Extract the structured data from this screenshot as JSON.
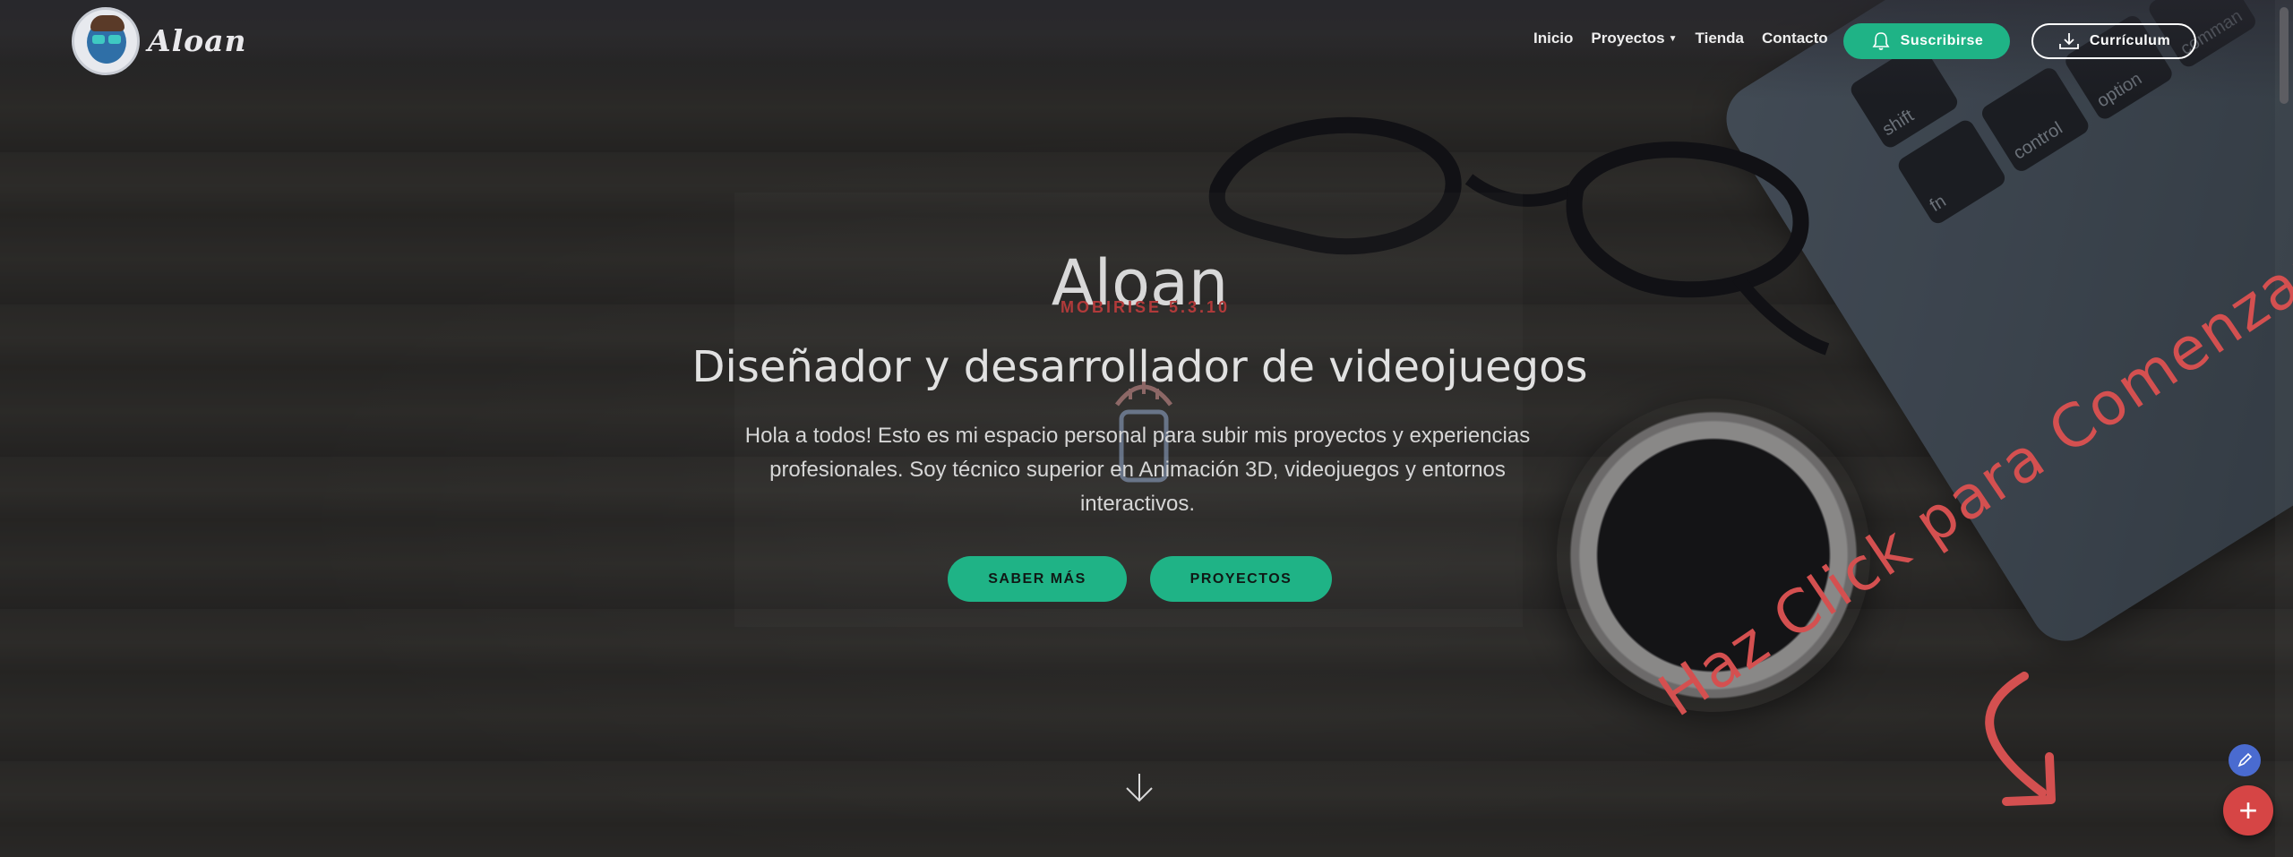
{
  "nav": {
    "brand": "Aloan",
    "items": [
      {
        "label": "Inicio"
      },
      {
        "label": "Proyectos",
        "has_caret": true
      },
      {
        "label": "Tienda"
      },
      {
        "label": "Contacto"
      }
    ],
    "subscribe_label": "Suscribirse",
    "cv_label": "Currículum",
    "icons": [
      "bell-icon",
      "download-icon"
    ]
  },
  "hero": {
    "title": "Aloan",
    "badge": "MOBIRISE 5.3.10",
    "subtitle": "Diseñador y desarrollador de videojuegos",
    "description": "Hola a todos! Esto es mi espacio personal para subir mis proyectos y experiencias profesionales. Soy técnico superior en Animación 3D, videojuegos y entornos interactivos.",
    "buttons": [
      {
        "label": "SABER MÁS"
      },
      {
        "label": "PROYECTOS"
      }
    ]
  },
  "overlay": {
    "hint": "Haz Click para Comenzar"
  },
  "background_keys": [
    "shift",
    "fn",
    "control",
    "option",
    "comman"
  ],
  "colors": {
    "accent": "#1fb386",
    "hint": "#d45050",
    "fab_add": "#d64545",
    "fab_edit": "#4a6bd0"
  }
}
